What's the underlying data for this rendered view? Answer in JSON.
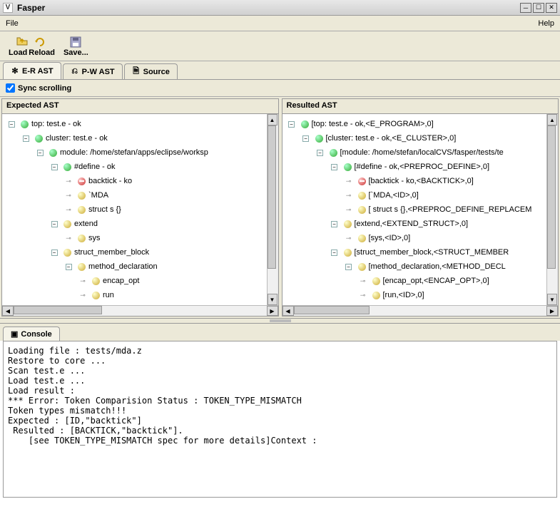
{
  "window": {
    "title": "Fasper",
    "icon_letter": "V"
  },
  "menu": {
    "file": "File",
    "help": "Help"
  },
  "toolbar": {
    "load": "Load",
    "reload": "Reload",
    "save": "Save..."
  },
  "tabs": {
    "er": "E-R AST",
    "pw": "P-W AST",
    "source": "Source"
  },
  "sync": {
    "label": "Sync scrolling"
  },
  "panes": {
    "expected": "Expected AST",
    "resulted": "Resulted AST"
  },
  "tree_expected": [
    {
      "depth": 0,
      "handle": "expand",
      "ball": "green",
      "label": "top: test.e - ok"
    },
    {
      "depth": 1,
      "handle": "expand",
      "ball": "green",
      "label": "cluster: test.e - ok"
    },
    {
      "depth": 2,
      "handle": "expand",
      "ball": "green",
      "label": "module: /home/stefan/apps/eclipse/worksp"
    },
    {
      "depth": 3,
      "handle": "expand",
      "ball": "green",
      "label": "#define - ok"
    },
    {
      "depth": 4,
      "handle": "leaf",
      "ball": "red",
      "label": "backtick - ko"
    },
    {
      "depth": 4,
      "handle": "leaf",
      "ball": "yellow",
      "label": "`MDA"
    },
    {
      "depth": 4,
      "handle": "leaf",
      "ball": "yellow",
      "label": "struct s {}"
    },
    {
      "depth": 3,
      "handle": "expand",
      "ball": "yellow",
      "label": "extend"
    },
    {
      "depth": 4,
      "handle": "leaf",
      "ball": "yellow",
      "label": "sys"
    },
    {
      "depth": 3,
      "handle": "expand",
      "ball": "yellow",
      "label": "struct_member_block"
    },
    {
      "depth": 4,
      "handle": "expand",
      "ball": "yellow",
      "label": "method_declaration"
    },
    {
      "depth": 5,
      "handle": "leaf",
      "ball": "yellow",
      "label": "encap_opt"
    },
    {
      "depth": 5,
      "handle": "leaf",
      "ball": "yellow",
      "label": "run"
    }
  ],
  "tree_resulted": [
    {
      "depth": 0,
      "handle": "expand",
      "ball": "green",
      "label": "[top: test.e - ok,<E_PROGRAM>,0]"
    },
    {
      "depth": 1,
      "handle": "expand",
      "ball": "green",
      "label": "[cluster: test.e - ok,<E_CLUSTER>,0]"
    },
    {
      "depth": 2,
      "handle": "expand",
      "ball": "green",
      "label": "[module: /home/stefan/localCVS/fasper/tests/te"
    },
    {
      "depth": 3,
      "handle": "expand",
      "ball": "green",
      "label": "[#define - ok,<PREPROC_DEFINE>,0]"
    },
    {
      "depth": 4,
      "handle": "leaf",
      "ball": "red",
      "label": "[backtick - ko,<BACKTICK>,0]"
    },
    {
      "depth": 4,
      "handle": "leaf",
      "ball": "yellow",
      "label": "[`MDA,<ID>,0]"
    },
    {
      "depth": 4,
      "handle": "leaf",
      "ball": "yellow",
      "label": "[ struct s {},<PREPROC_DEFINE_REPLACEM"
    },
    {
      "depth": 3,
      "handle": "expand",
      "ball": "yellow",
      "label": "[extend,<EXTEND_STRUCT>,0]"
    },
    {
      "depth": 4,
      "handle": "leaf",
      "ball": "yellow",
      "label": "[sys,<ID>,0]"
    },
    {
      "depth": 3,
      "handle": "expand",
      "ball": "yellow",
      "label": "[struct_member_block,<STRUCT_MEMBER"
    },
    {
      "depth": 4,
      "handle": "expand",
      "ball": "yellow",
      "label": "[method_declaration,<METHOD_DECL"
    },
    {
      "depth": 5,
      "handle": "leaf",
      "ball": "yellow",
      "label": "[encap_opt,<ENCAP_OPT>,0]"
    },
    {
      "depth": 5,
      "handle": "leaf",
      "ball": "yellow",
      "label": "[run,<ID>,0]"
    }
  ],
  "console": {
    "title": "Console",
    "text": "Loading file : tests/mda.z\nRestore to core ...\nScan test.e ...\nLoad test.e ...\nLoad result :\n*** Error: Token Comparision Status : TOKEN_TYPE_MISMATCH\nToken types mismatch!!!\nExpected : [ID,\"backtick\"]\n Resulted : [BACKTICK,\"backtick\"].\n    [see TOKEN_TYPE_MISMATCH spec for more details]Context :"
  }
}
